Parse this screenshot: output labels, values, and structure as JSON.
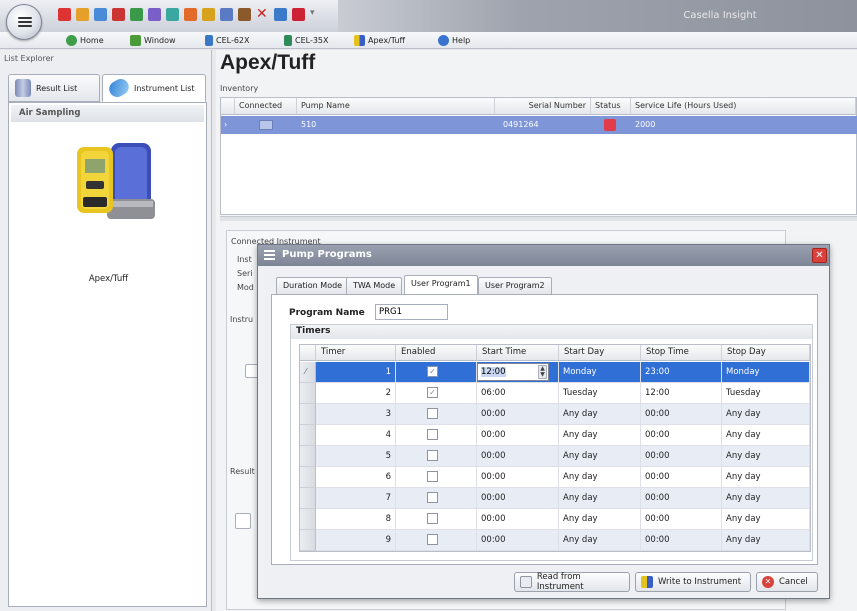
{
  "window": {
    "title": "Casella Insight"
  },
  "ribbon": {
    "tabs": [
      {
        "label": "Home",
        "icon": "home-icon"
      },
      {
        "label": "Window",
        "icon": "window-icon"
      },
      {
        "label": "CEL-62X",
        "icon": "cel62x-icon"
      },
      {
        "label": "CEL-35X",
        "icon": "cel35x-icon"
      },
      {
        "label": "Apex/Tuff",
        "icon": "apex-tuff-icon"
      },
      {
        "label": "Help",
        "icon": "help-icon"
      }
    ]
  },
  "left_pane": {
    "title": "List Explorer",
    "tabs": [
      {
        "label": "Result List"
      },
      {
        "label": "Instrument List"
      }
    ],
    "section": "Air Sampling",
    "device_label": "Apex/Tuff"
  },
  "main": {
    "page_title": "Apex/Tuff",
    "inventory_label": "Inventory",
    "columns": [
      "Connected",
      "Pump Name",
      "Serial Number",
      "Status",
      "Service Life (Hours Used)"
    ],
    "rows": [
      {
        "pump_name": "510",
        "serial": "0491264",
        "service_life": "2000"
      }
    ],
    "background_labels": [
      "Connected Instrument",
      "Inst",
      "Seri",
      "Mod",
      "Instru",
      "Result"
    ]
  },
  "dialog": {
    "title": "Pump Programs",
    "tabs": [
      "Duration Mode",
      "TWA Mode",
      "User Program1",
      "User Program2"
    ],
    "program_name_label": "Program Name",
    "program_name_value": "PRG1",
    "timers_label": "Timers",
    "columns": [
      "Timer",
      "Enabled",
      "Start Time",
      "Start Day",
      "Stop Time",
      "Stop Day"
    ],
    "rows": [
      {
        "timer": "1",
        "enabled": true,
        "start_time": "12:00",
        "start_day": "Monday",
        "stop_time": "23:00",
        "stop_day": "Monday"
      },
      {
        "timer": "2",
        "enabled": true,
        "start_time": "06:00",
        "start_day": "Tuesday",
        "stop_time": "12:00",
        "stop_day": "Tuesday"
      },
      {
        "timer": "3",
        "enabled": false,
        "start_time": "00:00",
        "start_day": "Any day",
        "stop_time": "00:00",
        "stop_day": "Any day"
      },
      {
        "timer": "4",
        "enabled": false,
        "start_time": "00:00",
        "start_day": "Any day",
        "stop_time": "00:00",
        "stop_day": "Any day"
      },
      {
        "timer": "5",
        "enabled": false,
        "start_time": "00:00",
        "start_day": "Any day",
        "stop_time": "00:00",
        "stop_day": "Any day"
      },
      {
        "timer": "6",
        "enabled": false,
        "start_time": "00:00",
        "start_day": "Any day",
        "stop_time": "00:00",
        "stop_day": "Any day"
      },
      {
        "timer": "7",
        "enabled": false,
        "start_time": "00:00",
        "start_day": "Any day",
        "stop_time": "00:00",
        "stop_day": "Any day"
      },
      {
        "timer": "8",
        "enabled": false,
        "start_time": "00:00",
        "start_day": "Any day",
        "stop_time": "00:00",
        "stop_day": "Any day"
      },
      {
        "timer": "9",
        "enabled": false,
        "start_time": "00:00",
        "start_day": "Any day",
        "stop_time": "00:00",
        "stop_day": "Any day"
      }
    ],
    "buttons": {
      "read": "Read from Instrument",
      "write": "Write to Instrument",
      "cancel": "Cancel"
    }
  },
  "colors": {
    "selection": "#2f6fd6",
    "inventory_selection": "#7e95d7",
    "alt_row": "#e7ecf5",
    "close_button": "#d9413a"
  }
}
